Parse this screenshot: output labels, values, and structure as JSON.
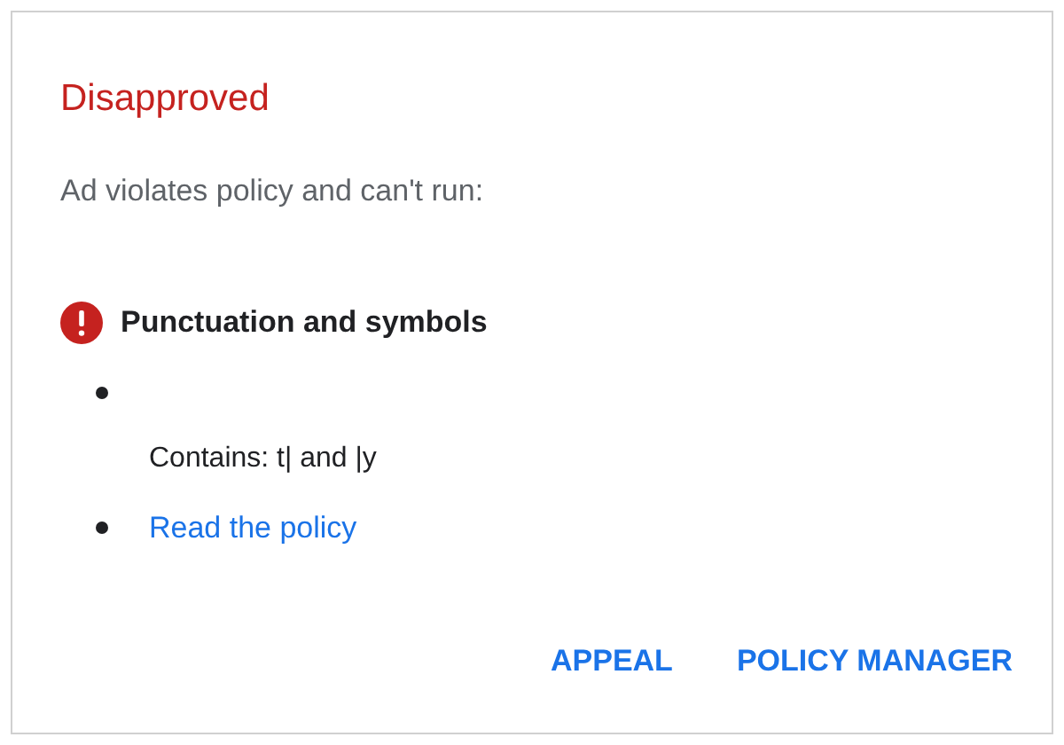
{
  "status": "Disapproved",
  "message": "Ad violates policy and can't run:",
  "violations": [
    {
      "title": "Punctuation and symbols",
      "details": [
        {
          "kind": "note",
          "text": "Contains: t| and |y"
        },
        {
          "kind": "link",
          "text": "Read the policy"
        }
      ]
    }
  ],
  "buttons": [
    "APPEAL",
    "POLICY MANAGER"
  ]
}
